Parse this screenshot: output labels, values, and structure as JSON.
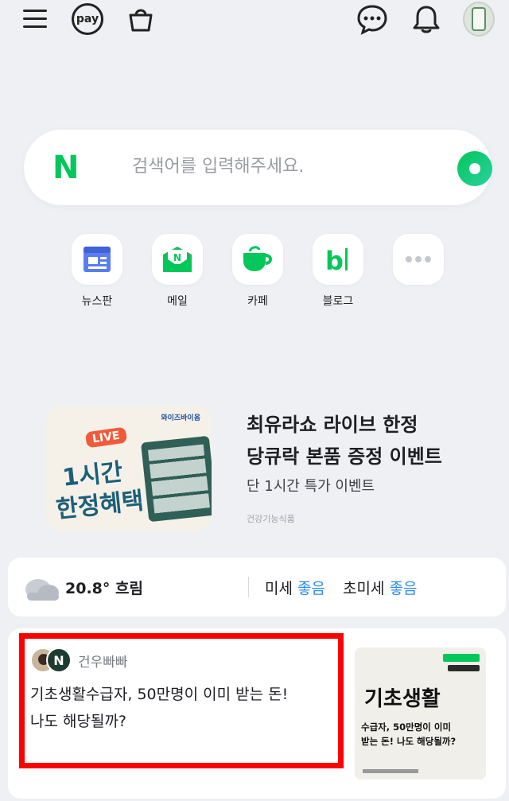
{
  "topbar": {
    "menu_icon": "hamburger-menu-icon",
    "pay_label": "pay",
    "shopping_icon": "shopping-basket-icon",
    "chat_icon": "chat-bubble-icon",
    "notification_icon": "bell-icon",
    "profile_icon": "profile-avatar"
  },
  "search": {
    "logo": "N",
    "placeholder": "검색어를 입력해주세요.",
    "lens_icon": "green-dot-lens-icon"
  },
  "shortcuts": [
    {
      "label": "뉴스판",
      "icon": "newspaper-icon"
    },
    {
      "label": "메일",
      "icon": "mail-icon"
    },
    {
      "label": "카페",
      "icon": "cafe-cup-icon"
    },
    {
      "label": "블로그",
      "icon": "blog-icon"
    },
    {
      "label": "",
      "icon": "more-icon"
    }
  ],
  "ad": {
    "image_brand": "와이즈바이옴",
    "image_live": "LIVE",
    "image_line1": "1시간",
    "image_line2": "한정혜택",
    "title_line1": "최유라쇼 라이브 한정",
    "title_line2": "당큐락 본품 증정 이벤트",
    "subtitle": "단 1시간 특가 이벤트",
    "tag": "건강기능식품"
  },
  "weather": {
    "icon": "cloudy-icon",
    "temp": "20.8° 흐림",
    "dust_label": "미세",
    "dust_value": "좋음",
    "ultrafine_label": "초미세",
    "ultrafine_value": "좋음"
  },
  "feed": {
    "author": "건우빠빠",
    "author_badge": "N",
    "headline_line1": "기초생활수급자, 50만명이 이미 받는 돈!",
    "headline_line2": "나도 해당될까?",
    "thumb_title": "기초생활",
    "thumb_line1": "수급자, 50만명이 이미",
    "thumb_line2": "받는 돈! 나도 해당될까?"
  },
  "colors": {
    "background": "#eef0f4",
    "naver_green": "#03c75a",
    "good_blue": "#2e8cf0",
    "highlight_red": "#ff0000"
  }
}
